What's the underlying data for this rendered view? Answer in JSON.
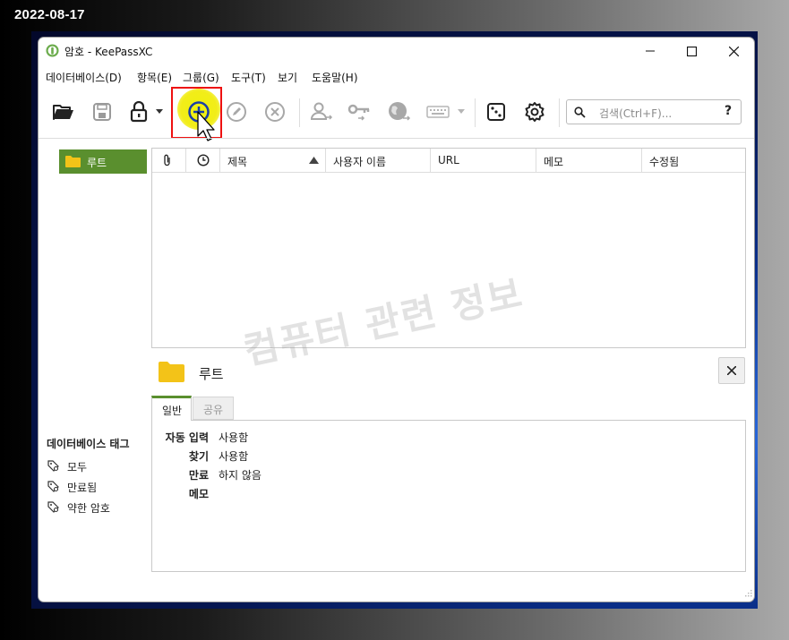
{
  "date_stamp": "2022-08-17",
  "window": {
    "title": "암호 - KeePassXC"
  },
  "menu": [
    "데이터베이스(D)",
    "항목(E)",
    "그룹(G)",
    "도구(T)",
    "보기",
    "도움말(H)"
  ],
  "toolbar": {
    "icons": [
      "open-database-icon",
      "save-database-icon",
      "lock-database-icon",
      "add-entry-icon",
      "edit-entry-icon",
      "delete-entry-icon",
      "copy-username-icon",
      "copy-password-icon",
      "copy-url-icon",
      "autotype-icon",
      "password-generator-icon",
      "settings-icon"
    ],
    "search_placeholder": "검색(Ctrl+F)...",
    "search_help": "?"
  },
  "tree": {
    "root_label": "루트"
  },
  "table": {
    "columns": [
      "제목",
      "사용자 이름",
      "URL",
      "메모",
      "수정됨"
    ],
    "rows": []
  },
  "watermark": "컴퓨터 관련 정보",
  "group_panel": {
    "title": "루트",
    "tabs": [
      "일반",
      "공유"
    ],
    "details": [
      {
        "key": "자동 입력",
        "value": "사용함"
      },
      {
        "key": "찾기",
        "value": "사용함"
      },
      {
        "key": "만료",
        "value": "하지 않음"
      },
      {
        "key": "메모",
        "value": ""
      }
    ]
  },
  "tags": {
    "title": "데이터베이스 태그",
    "items": [
      "모두",
      "만료됨",
      "약한 암호"
    ]
  },
  "colors": {
    "accent": "#5a8f2e",
    "highlight": "#f0eb00",
    "annotation": "#ee1111",
    "folder": "#f3c318"
  }
}
